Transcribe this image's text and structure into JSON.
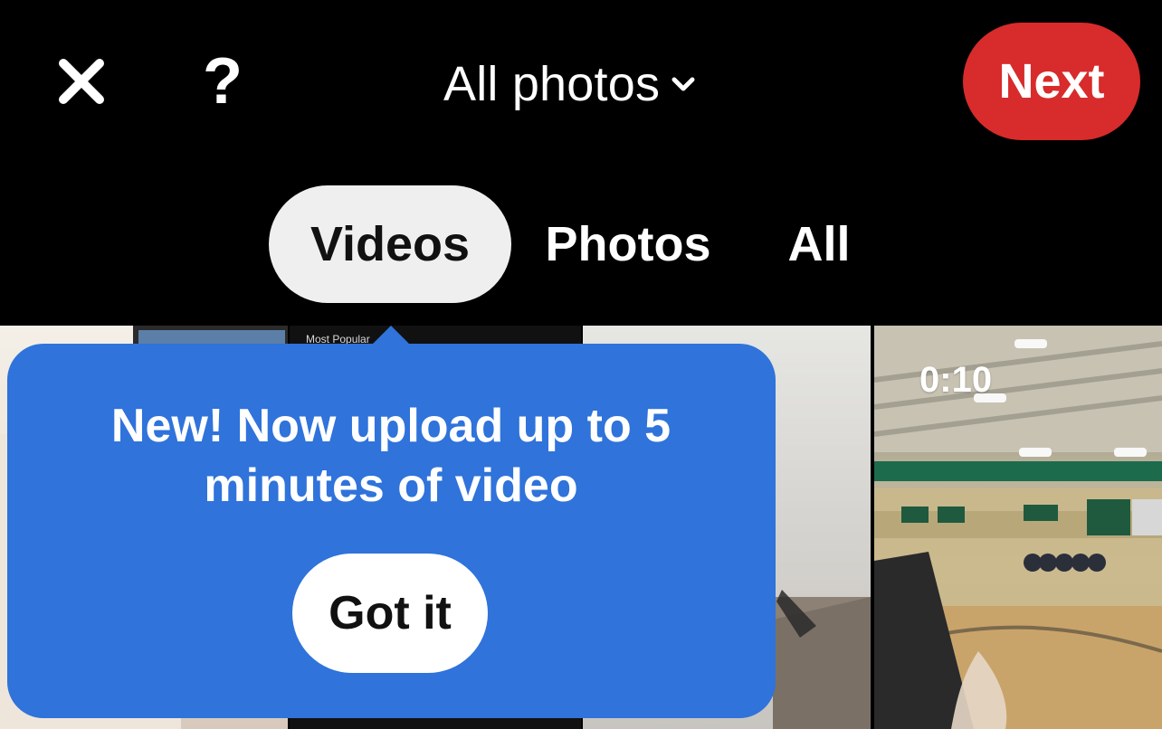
{
  "header": {
    "album_title": "All photos",
    "next_label": "Next"
  },
  "tabs": [
    {
      "label": "Videos"
    },
    {
      "label": "Photos"
    },
    {
      "label": "All"
    }
  ],
  "media": {
    "tile_2_caption": "Most Popular",
    "tile_4_duration": "0:10"
  },
  "tooltip": {
    "text": "New! Now upload up to 5 minutes of video",
    "button_label": "Got it"
  },
  "colors": {
    "accent_red": "#d82b2b",
    "tooltip_blue": "#2f73db",
    "background": "#000000"
  }
}
